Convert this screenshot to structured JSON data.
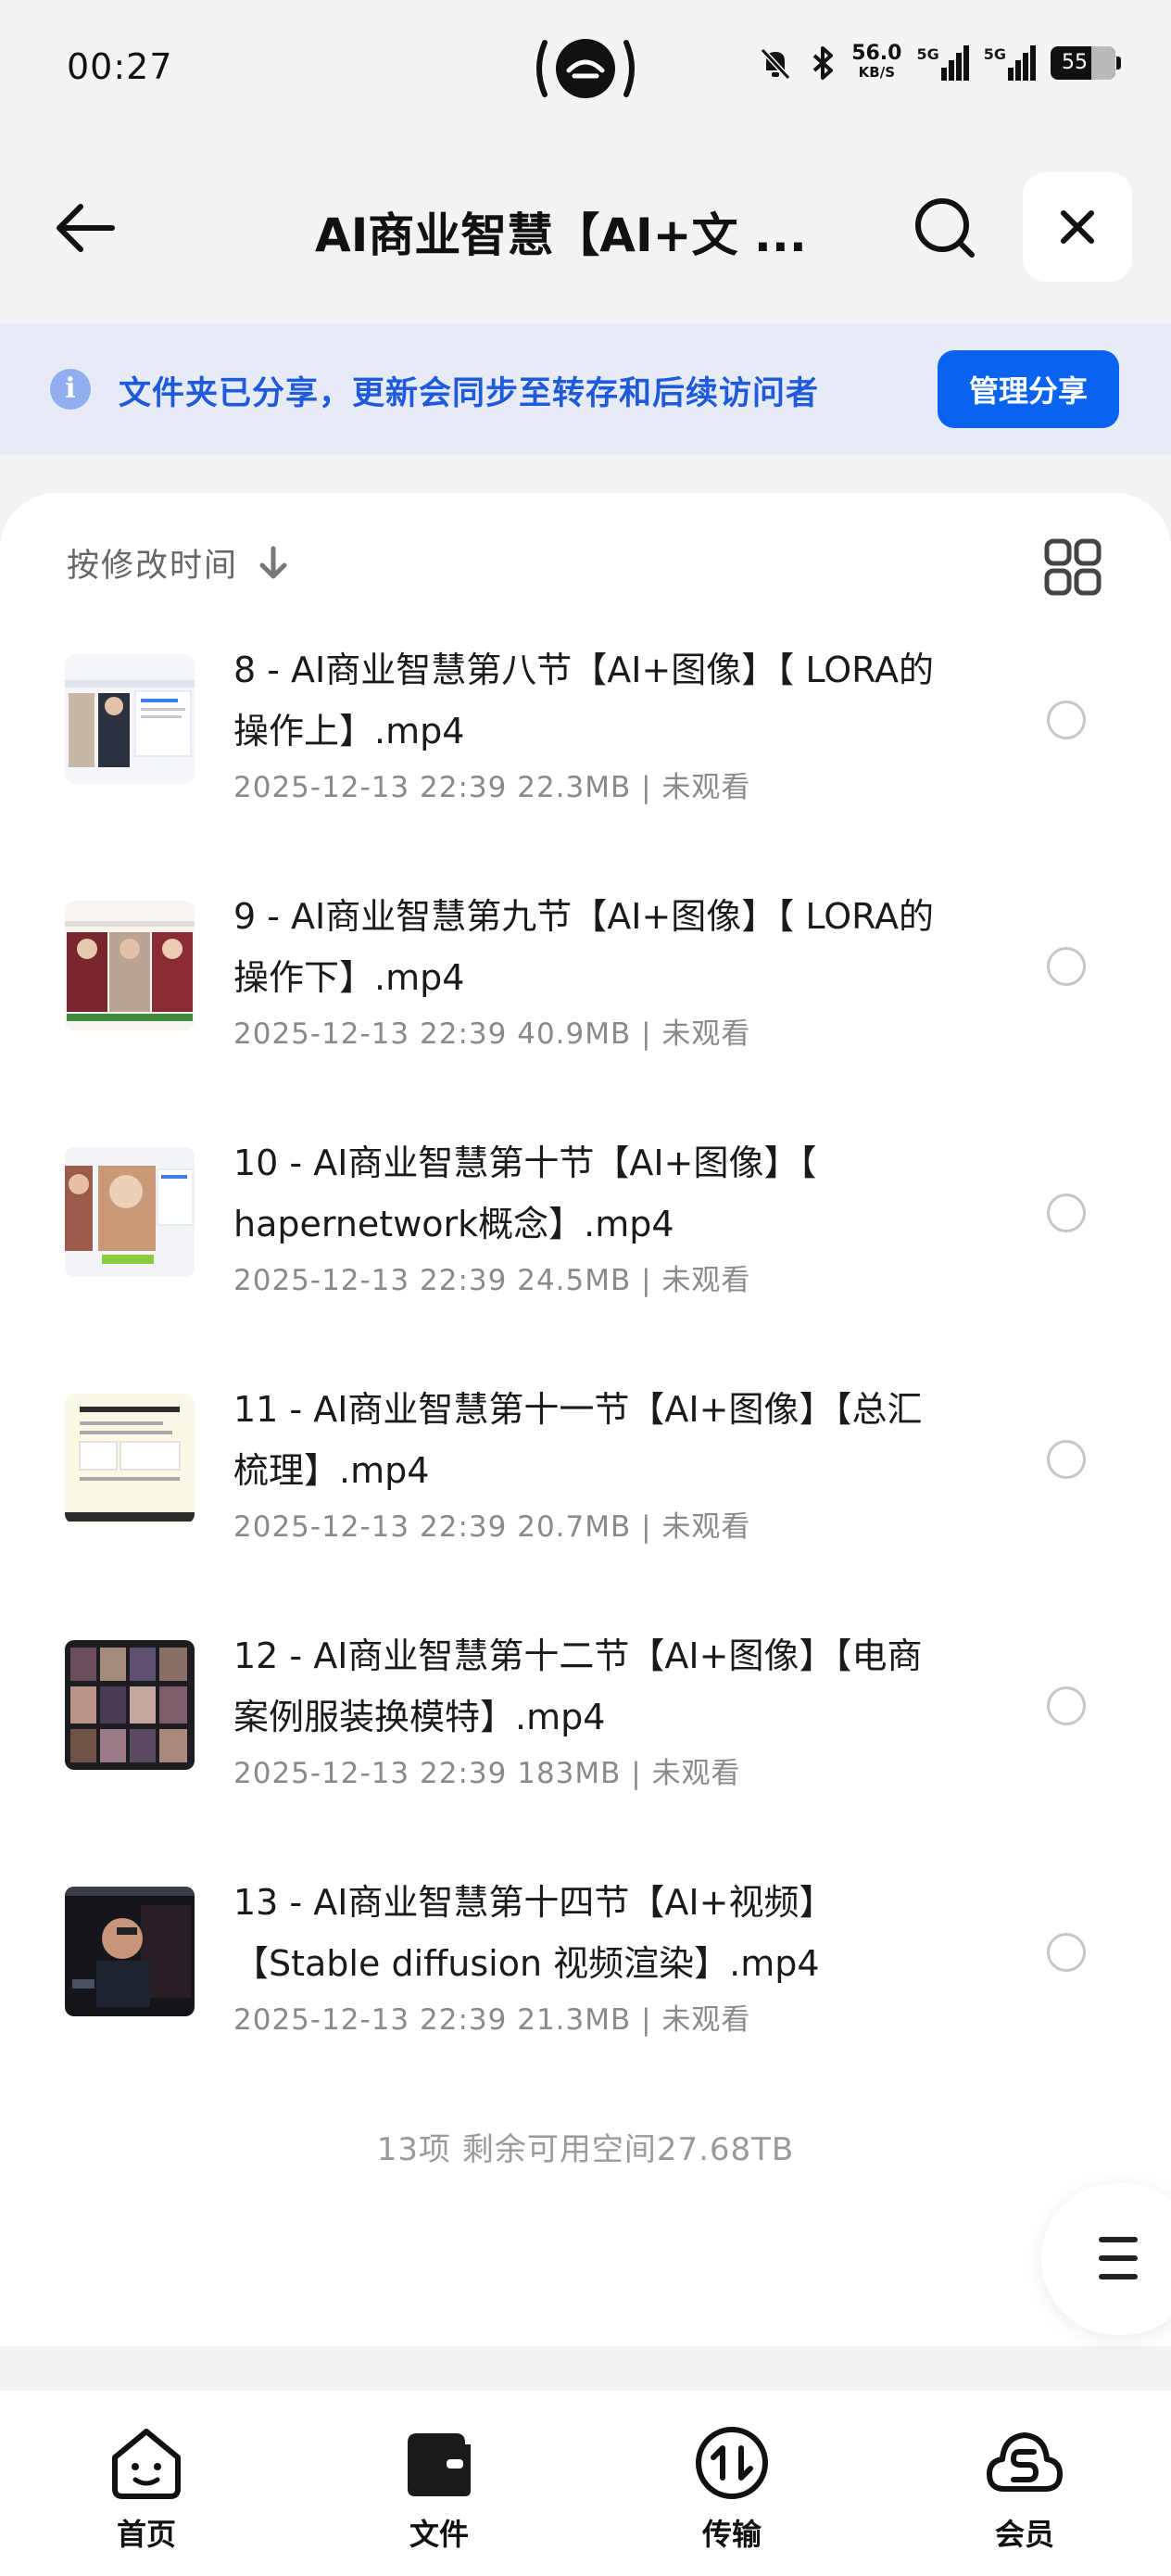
{
  "status_bar": {
    "time": "00:27",
    "net_speed": "56.0",
    "net_speed_unit": "KB/S",
    "signal_1": "5G",
    "signal_2": "5G",
    "battery": "55"
  },
  "header": {
    "title": "AI商业智慧【AI+文 ..."
  },
  "share_banner": {
    "text": "文件夹已分享，更新会同步至转存和后续访问者",
    "button_label": "管理分享"
  },
  "sort": {
    "label": "按修改时间"
  },
  "files": [
    {
      "name": "8 - AI商业智慧第八节【AI+图像】【 LORA的操作上】.mp4",
      "date": "2025-12-13 22:39",
      "size": "22.3MB",
      "status": "未观看"
    },
    {
      "name": "9 - AI商业智慧第九节【AI+图像】【 LORA的操作下】.mp4",
      "date": "2025-12-13 22:39",
      "size": "40.9MB",
      "status": "未观看"
    },
    {
      "name": "10 - AI商业智慧第十节【AI+图像】【 hapernetwork概念】.mp4",
      "date": "2025-12-13 22:39",
      "size": "24.5MB",
      "status": "未观看"
    },
    {
      "name": "11 - AI商业智慧第十一节【AI+图像】【总汇梳理】.mp4",
      "date": "2025-12-13 22:39",
      "size": "20.7MB",
      "status": "未观看"
    },
    {
      "name": "12 - AI商业智慧第十二节【AI+图像】【电商案例服装换模特】.mp4",
      "date": "2025-12-13 22:39",
      "size": "183MB",
      "status": "未观看"
    },
    {
      "name": "13 - AI商业智慧第十四节【AI+视频】【Stable diffusion 视频渲染】.mp4",
      "date": "2025-12-13 22:39",
      "size": "21.3MB",
      "status": "未观看"
    }
  ],
  "footer": {
    "summary": "13项 剩余可用空间27.68TB"
  },
  "bottom_nav": [
    {
      "label": "首页",
      "icon": "home-face-icon"
    },
    {
      "label": "文件",
      "icon": "folder-wallet-icon"
    },
    {
      "label": "传输",
      "icon": "transfer-icon"
    },
    {
      "label": "会员",
      "icon": "vip-cloud-icon"
    }
  ],
  "colors": {
    "accent": "#0a63f0",
    "banner_bg": "#e6ebf6",
    "banner_text": "#1e5adb"
  }
}
